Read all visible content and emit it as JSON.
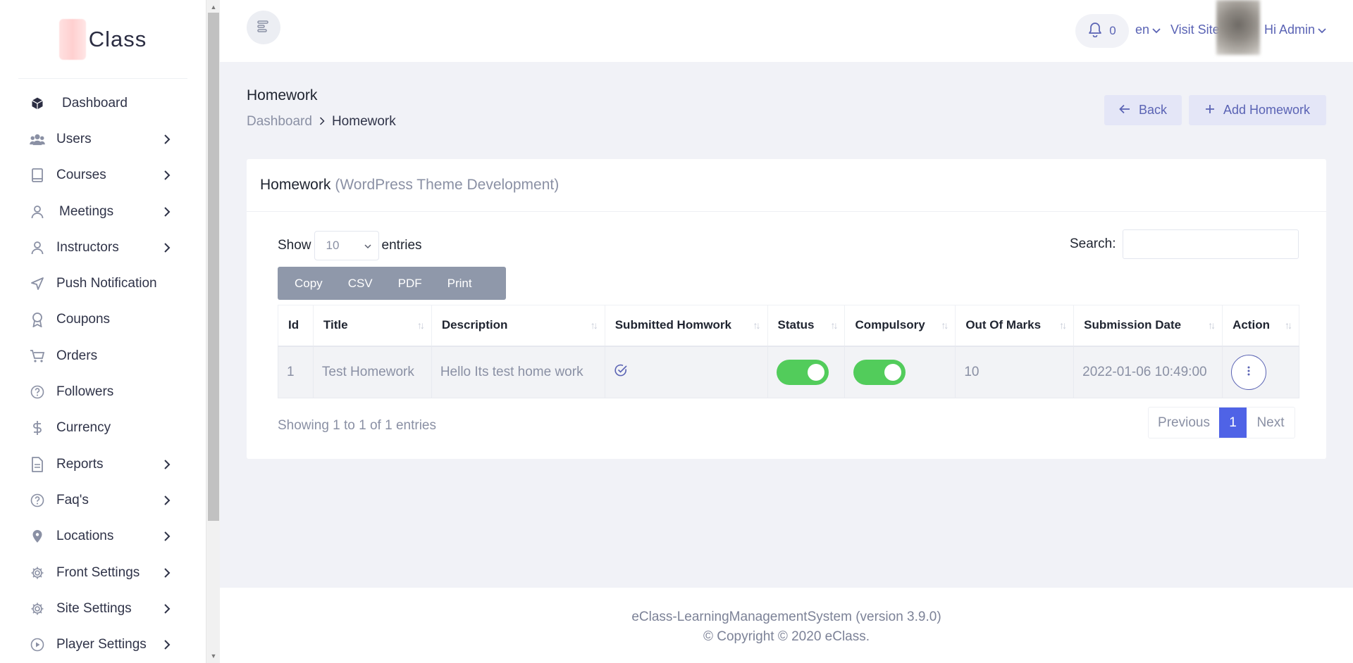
{
  "app": {
    "logo_text": "Class"
  },
  "sidebar": {
    "items": [
      {
        "label": "Dashboard",
        "icon": "cube-icon",
        "has_children": false
      },
      {
        "label": "Users",
        "icon": "users-icon",
        "has_children": true
      },
      {
        "label": "Courses",
        "icon": "book-icon",
        "has_children": true
      },
      {
        "label": "Meetings",
        "icon": "user-icon",
        "has_children": true
      },
      {
        "label": "Instructors",
        "icon": "user-icon",
        "has_children": true
      },
      {
        "label": "Push Notification",
        "icon": "send-icon",
        "has_children": false
      },
      {
        "label": "Coupons",
        "icon": "award-icon",
        "has_children": false
      },
      {
        "label": "Orders",
        "icon": "cart-icon",
        "has_children": false
      },
      {
        "label": "Followers",
        "icon": "help-circle-icon",
        "has_children": false
      },
      {
        "label": "Currency",
        "icon": "dollar-icon",
        "has_children": false
      },
      {
        "label": "Reports",
        "icon": "file-text-icon",
        "has_children": true
      },
      {
        "label": "Faq's",
        "icon": "help-circle-icon",
        "has_children": true
      },
      {
        "label": "Locations",
        "icon": "map-pin-icon",
        "has_children": true
      },
      {
        "label": "Front Settings",
        "icon": "gear-icon",
        "has_children": true
      },
      {
        "label": "Site Settings",
        "icon": "gear-icon",
        "has_children": true
      },
      {
        "label": "Player Settings",
        "icon": "play-circle-icon",
        "has_children": true
      }
    ]
  },
  "header": {
    "notification_count": "0",
    "language": "en",
    "visit_site": "Visit Site",
    "greeting": "Hi Admin"
  },
  "page": {
    "title": "Homework",
    "breadcrumb": {
      "root": "Dashboard",
      "current": "Homework"
    },
    "back_label": "Back",
    "add_label": "Add Homework"
  },
  "card": {
    "title": "Homework",
    "subtitle": "(WordPress Theme Development)",
    "show_label": "Show",
    "page_size": "10",
    "entries_label": "entries",
    "search_label": "Search:",
    "export_buttons": [
      "Copy",
      "CSV",
      "PDF",
      "Print"
    ],
    "columns": [
      "Id",
      "Title",
      "Description",
      "Submitted Homwork",
      "Status",
      "Compulsory",
      "Out Of Marks",
      "Submission Date",
      "Action"
    ],
    "rows": [
      {
        "id": "1",
        "title": "Test Homework",
        "description": "Hello Its test home work",
        "status_on": true,
        "compulsory_on": true,
        "out_of_marks": "10",
        "submission_date": "2022-01-06 10:49:00"
      }
    ],
    "info": "Showing 1 to 1 of 1 entries",
    "pagination": {
      "previous": "Previous",
      "current": "1",
      "next": "Next"
    }
  },
  "footer": {
    "line1": "eClass-LearningManagementSystem (version 3.9.0)",
    "line2": "© Copyright © 2020 eClass."
  },
  "colors": {
    "accent": "#5a63b4",
    "primary": "#4f63e6",
    "toggle_on": "#52cc5b",
    "export_bg": "#8f98aa"
  }
}
